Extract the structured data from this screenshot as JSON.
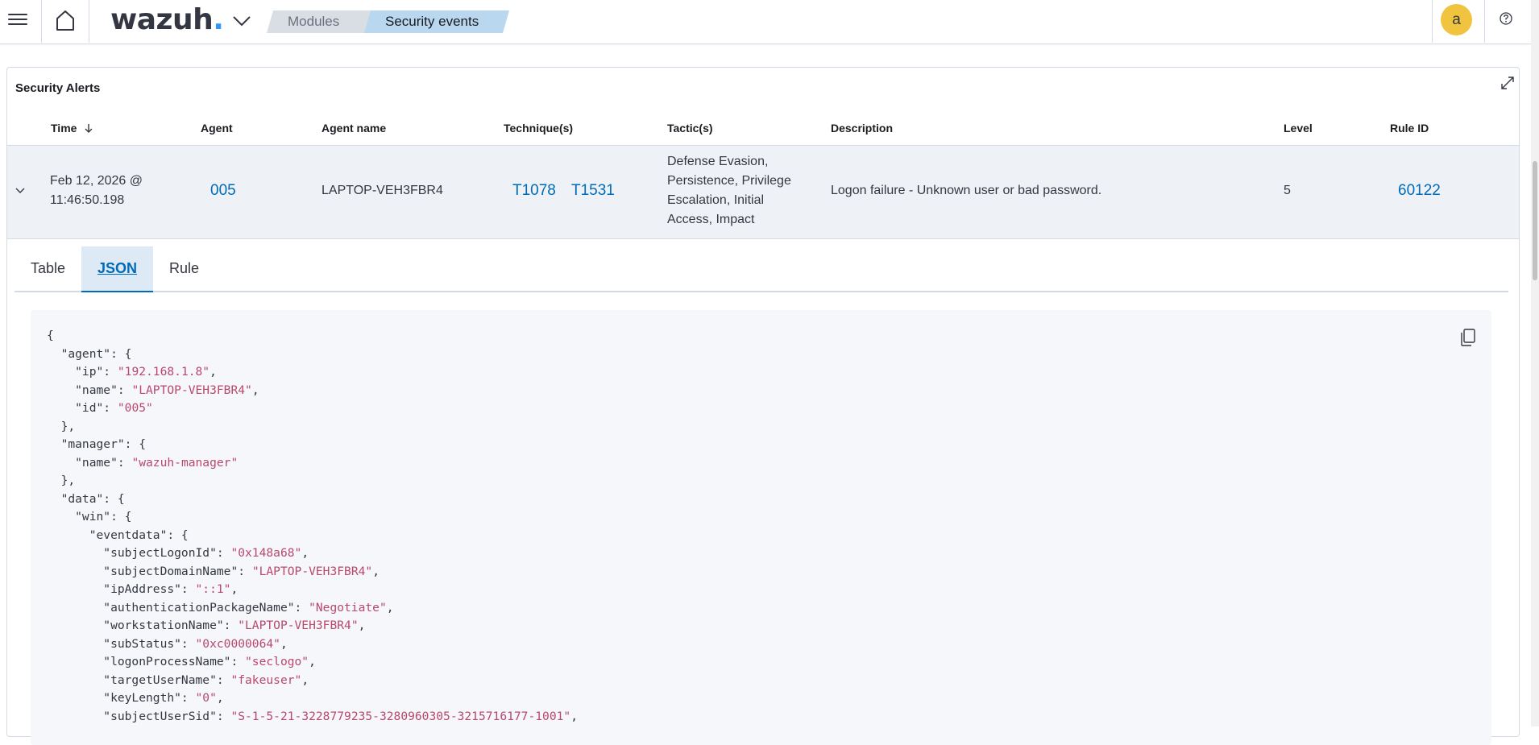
{
  "header": {
    "logo_text": "wazuh",
    "logo_dot": ".",
    "breadcrumbs": [
      "Modules",
      "Security events"
    ],
    "avatar_letter": "a"
  },
  "panel": {
    "title": "Security Alerts",
    "columns": [
      "Time",
      "Agent",
      "Agent name",
      "Technique(s)",
      "Tactic(s)",
      "Description",
      "Level",
      "Rule ID"
    ],
    "row": {
      "time_line1": "Feb 12, 2026 @",
      "time_line2": "11:46:50.198",
      "agent": "005",
      "agent_name": "LAPTOP-VEH3FBR4",
      "techniques": [
        "T1078",
        "T1531"
      ],
      "tactics_lines": [
        "Defense Evasion,",
        "Persistence, Privilege",
        "Escalation, Initial",
        "Access, Impact"
      ],
      "description": "Logon failure - Unknown user or bad password.",
      "level": "5",
      "rule_id": "60122"
    }
  },
  "tabs": [
    "Table",
    "JSON",
    "Rule"
  ],
  "active_tab": "JSON",
  "json_lines": [
    "{",
    "  \"agent\": {",
    "    \"ip\": \"192.168.1.8\",",
    "    \"name\": \"LAPTOP-VEH3FBR4\",",
    "    \"id\": \"005\"",
    "  },",
    "  \"manager\": {",
    "    \"name\": \"wazuh-manager\"",
    "  },",
    "  \"data\": {",
    "    \"win\": {",
    "      \"eventdata\": {",
    "        \"subjectLogonId\": \"0x148a68\",",
    "        \"subjectDomainName\": \"LAPTOP-VEH3FBR4\",",
    "        \"ipAddress\": \"::1\",",
    "        \"authenticationPackageName\": \"Negotiate\",",
    "        \"workstationName\": \"LAPTOP-VEH3FBR4\",",
    "        \"subStatus\": \"0xc0000064\",",
    "        \"logonProcessName\": \"seclogo\",",
    "        \"targetUserName\": \"fakeuser\",",
    "        \"keyLength\": \"0\",",
    "        \"subjectUserSid\": \"S-1-5-21-3228779235-3280960305-3215716177-1001\","
  ],
  "colors": {
    "accent": "#006bb8",
    "json_string": "#b9486b",
    "avatar_bg": "#f0c43e",
    "row_bg": "#eef2f7"
  }
}
